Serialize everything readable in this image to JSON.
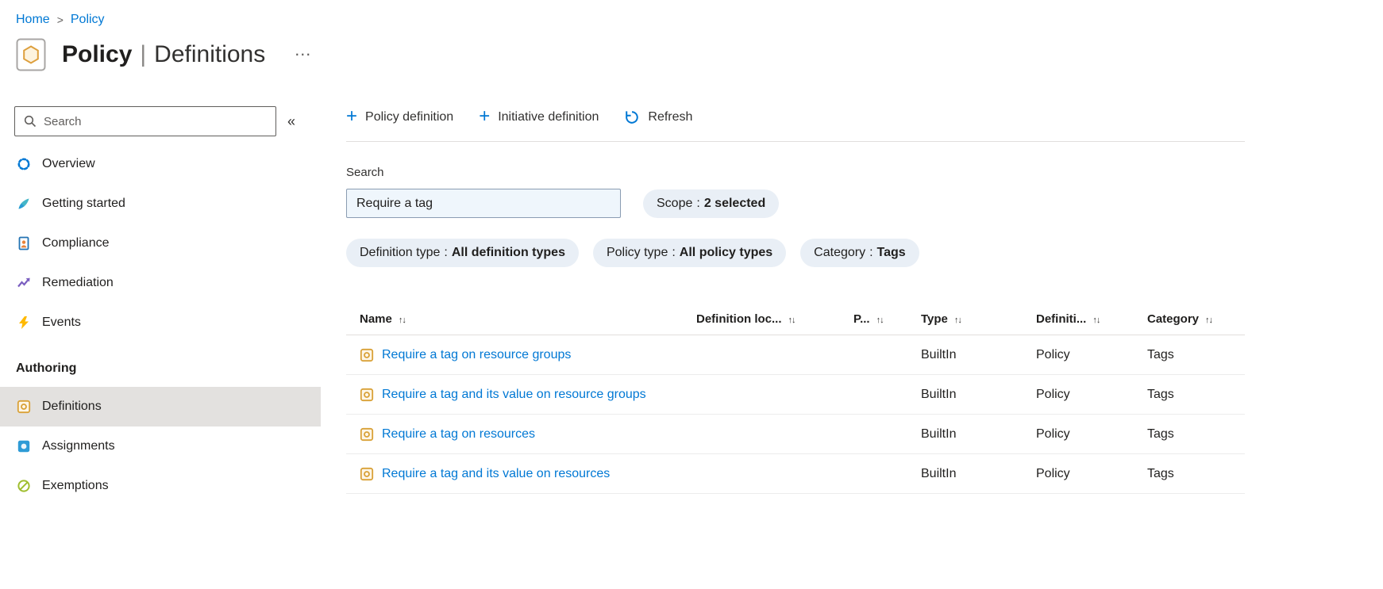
{
  "breadcrumb": {
    "items": [
      "Home",
      "Policy"
    ],
    "separator": ">"
  },
  "header": {
    "title_primary": "Policy",
    "title_separator": "|",
    "title_secondary": "Definitions",
    "more_glyph": "…"
  },
  "sidebar": {
    "search_placeholder": "Search",
    "collapse_glyph": "«",
    "items": [
      {
        "label": "Overview"
      },
      {
        "label": "Getting started"
      },
      {
        "label": "Compliance"
      },
      {
        "label": "Remediation"
      },
      {
        "label": "Events"
      }
    ],
    "section_header": "Authoring",
    "authoring_items": [
      {
        "label": "Definitions",
        "selected": true
      },
      {
        "label": "Assignments",
        "selected": false
      },
      {
        "label": "Exemptions",
        "selected": false
      }
    ]
  },
  "toolbar": {
    "buttons": [
      {
        "label": "Policy definition",
        "icon_glyph": "+"
      },
      {
        "label": "Initiative definition",
        "icon_glyph": "+"
      },
      {
        "label": "Refresh"
      }
    ]
  },
  "filters": {
    "search_label": "Search",
    "search_value": "Require a tag",
    "colon": ":",
    "pills": [
      {
        "label": "Scope",
        "value": "2 selected"
      },
      {
        "label": "Definition type",
        "value": "All definition types"
      },
      {
        "label": "Policy type",
        "value": "All policy types"
      },
      {
        "label": "Category",
        "value": "Tags"
      }
    ]
  },
  "table": {
    "sort_glyph": "↑↓",
    "columns": [
      {
        "label": "Name"
      },
      {
        "label": "Definition loc..."
      },
      {
        "label": "P..."
      },
      {
        "label": "Type"
      },
      {
        "label": "Definiti..."
      },
      {
        "label": "Category"
      }
    ],
    "rows": [
      {
        "name": "Require a tag on resource groups",
        "definition_location": "",
        "policies": "",
        "type": "BuiltIn",
        "definition_type": "Policy",
        "category": "Tags"
      },
      {
        "name": "Require a tag and its value on resource groups",
        "definition_location": "",
        "policies": "",
        "type": "BuiltIn",
        "definition_type": "Policy",
        "category": "Tags"
      },
      {
        "name": "Require a tag on resources",
        "definition_location": "",
        "policies": "",
        "type": "BuiltIn",
        "definition_type": "Policy",
        "category": "Tags"
      },
      {
        "name": "Require a tag and its value on resources",
        "definition_location": "",
        "policies": "",
        "type": "BuiltIn",
        "definition_type": "Policy",
        "category": "Tags"
      }
    ]
  },
  "colors": {
    "accent": "#0078d4",
    "link": "#0078d4",
    "pill_background": "#e9eff6",
    "selected_item_background": "#e3e1df",
    "policy_icon_orange": "#d9a137",
    "events_yellow": "#ffb900"
  }
}
